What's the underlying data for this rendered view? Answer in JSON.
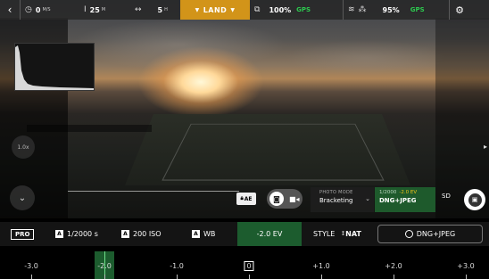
{
  "topbar": {
    "speed_value": "0",
    "speed_unit": "M/S",
    "altitude_value": "25",
    "altitude_unit": "M",
    "distance_value": "5",
    "distance_unit": "H",
    "land_label": "LAND",
    "drone_battery": "100%",
    "drone_gps": "GPS",
    "controller_battery": "95%",
    "controller_gps": "GPS"
  },
  "zoom_label": "1.0x",
  "camera": {
    "ae_lock_label": "AE",
    "photo_mode_label": "PHOTO MODE",
    "photo_mode_value": "Bracketing",
    "capture_shutter": "1/2000",
    "capture_ev": "-2.0 EV",
    "capture_format": "DNG+JPEG",
    "storage_label": "SD"
  },
  "settings": {
    "pro_label": "PRO",
    "shutter_badge": "A",
    "shutter_value": "1/2000 s",
    "iso_badge": "A",
    "iso_value": "200 ISO",
    "wb_badge": "A",
    "wb_value": "WB",
    "ev_value": "-2.0 EV",
    "style_label": "STYLE",
    "style_value": "NAT",
    "format_value": "DNG+JPEG"
  },
  "ev_scale": {
    "ticks": [
      "-3.0",
      "-2.0",
      "-1.0",
      "0",
      "+1.0",
      "+2.0",
      "+3.0"
    ],
    "selected": "-2.0"
  },
  "colors": {
    "accent_green": "#1c5c2e",
    "land_orange": "#d29419",
    "gps_green": "#2cc94f"
  },
  "icons": [
    "back-arrow-icon",
    "speed-icon",
    "altitude-icon",
    "distance-icon",
    "chevron-down-icon",
    "drone-battery-icon",
    "wifi-icon",
    "controller-icon",
    "gear-icon",
    "camera-icon",
    "video-icon",
    "shutter-icon"
  ]
}
